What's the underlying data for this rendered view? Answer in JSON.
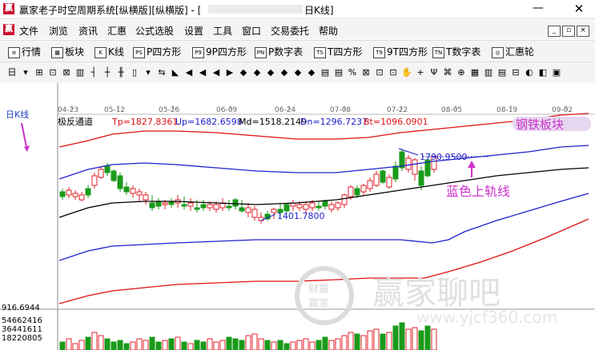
{
  "window": {
    "title": "赢家老子时空周期系统[纵横版][纵横版] - [",
    "title_tail": "日K线]",
    "minimize_glyph": "—",
    "close_glyph": "✕"
  },
  "menu": {
    "items": [
      "文件",
      "浏览",
      "资讯",
      "汇惠",
      "公式选股",
      "设置",
      "工具",
      "窗口",
      "交易委托",
      "帮助"
    ]
  },
  "toolbar1": {
    "items": [
      {
        "icon": "≡",
        "label": "行情"
      },
      {
        "icon": "▦",
        "label": "板块"
      },
      {
        "icon": "K",
        "label": "K线"
      },
      {
        "icon": "PS",
        "label": "P四方形"
      },
      {
        "icon": "P9",
        "label": "9P四方形"
      },
      {
        "icon": "PN",
        "label": "P数字表"
      },
      {
        "icon": "TS",
        "label": "T四方形"
      },
      {
        "icon": "T9",
        "label": "9T四方形"
      },
      {
        "icon": "TN",
        "label": "T数字表"
      },
      {
        "icon": "◎",
        "label": "汇惠轮"
      }
    ]
  },
  "toolbar2": {
    "icons": [
      "日",
      "▾",
      "⊞",
      "⊡",
      "⊠",
      "▥",
      "┤",
      "┼",
      "╫",
      "▯",
      "▾",
      "⇆",
      "◣",
      "◀",
      "◀",
      "◀",
      "▶",
      "◆",
      "◆",
      "◆",
      "◆",
      "◆",
      "◆",
      "▤",
      "▤",
      "%",
      "⊠",
      "⊡",
      "⊡",
      "✋",
      "+",
      "Ψ",
      "⌘",
      "⊕",
      "▦",
      "▥",
      "▤",
      "⊟",
      "◐",
      "◧",
      "▣",
      "▦"
    ]
  },
  "chart_data": {
    "type": "candlestick",
    "period_label": "日K线",
    "x_labels": [
      "04-23",
      "05-12",
      "05-26",
      "06-09",
      "06-24",
      "07-08",
      "07-22",
      "08-05",
      "08-19",
      "09-02"
    ],
    "indicator": {
      "name": "极反通道",
      "Tp": "Tp=1827.8361",
      "Up": "Up=1682.6598",
      "Md": "Md=1518.2149",
      "Dn": "Dn=1296.7237",
      "Bt": "Bt=1096.0901"
    },
    "annotations": {
      "sector": "钢铁板块",
      "high_price": "1790.9500",
      "low_price": "1401.7800",
      "blue_upper_rail": "蓝色上轨线"
    },
    "volume_axis": [
      "916.6944",
      "54662416",
      "36441611",
      "18220805"
    ],
    "watermark": {
      "brand": "赢家聊吧",
      "url": "www.yjcf360.com"
    },
    "colors": {
      "up": "#e0202a",
      "down": "#1a9a1a",
      "upper_channel": "#2020cc",
      "mid": "#000000",
      "outer": "#e01010",
      "annot": "#cc33cc"
    }
  }
}
